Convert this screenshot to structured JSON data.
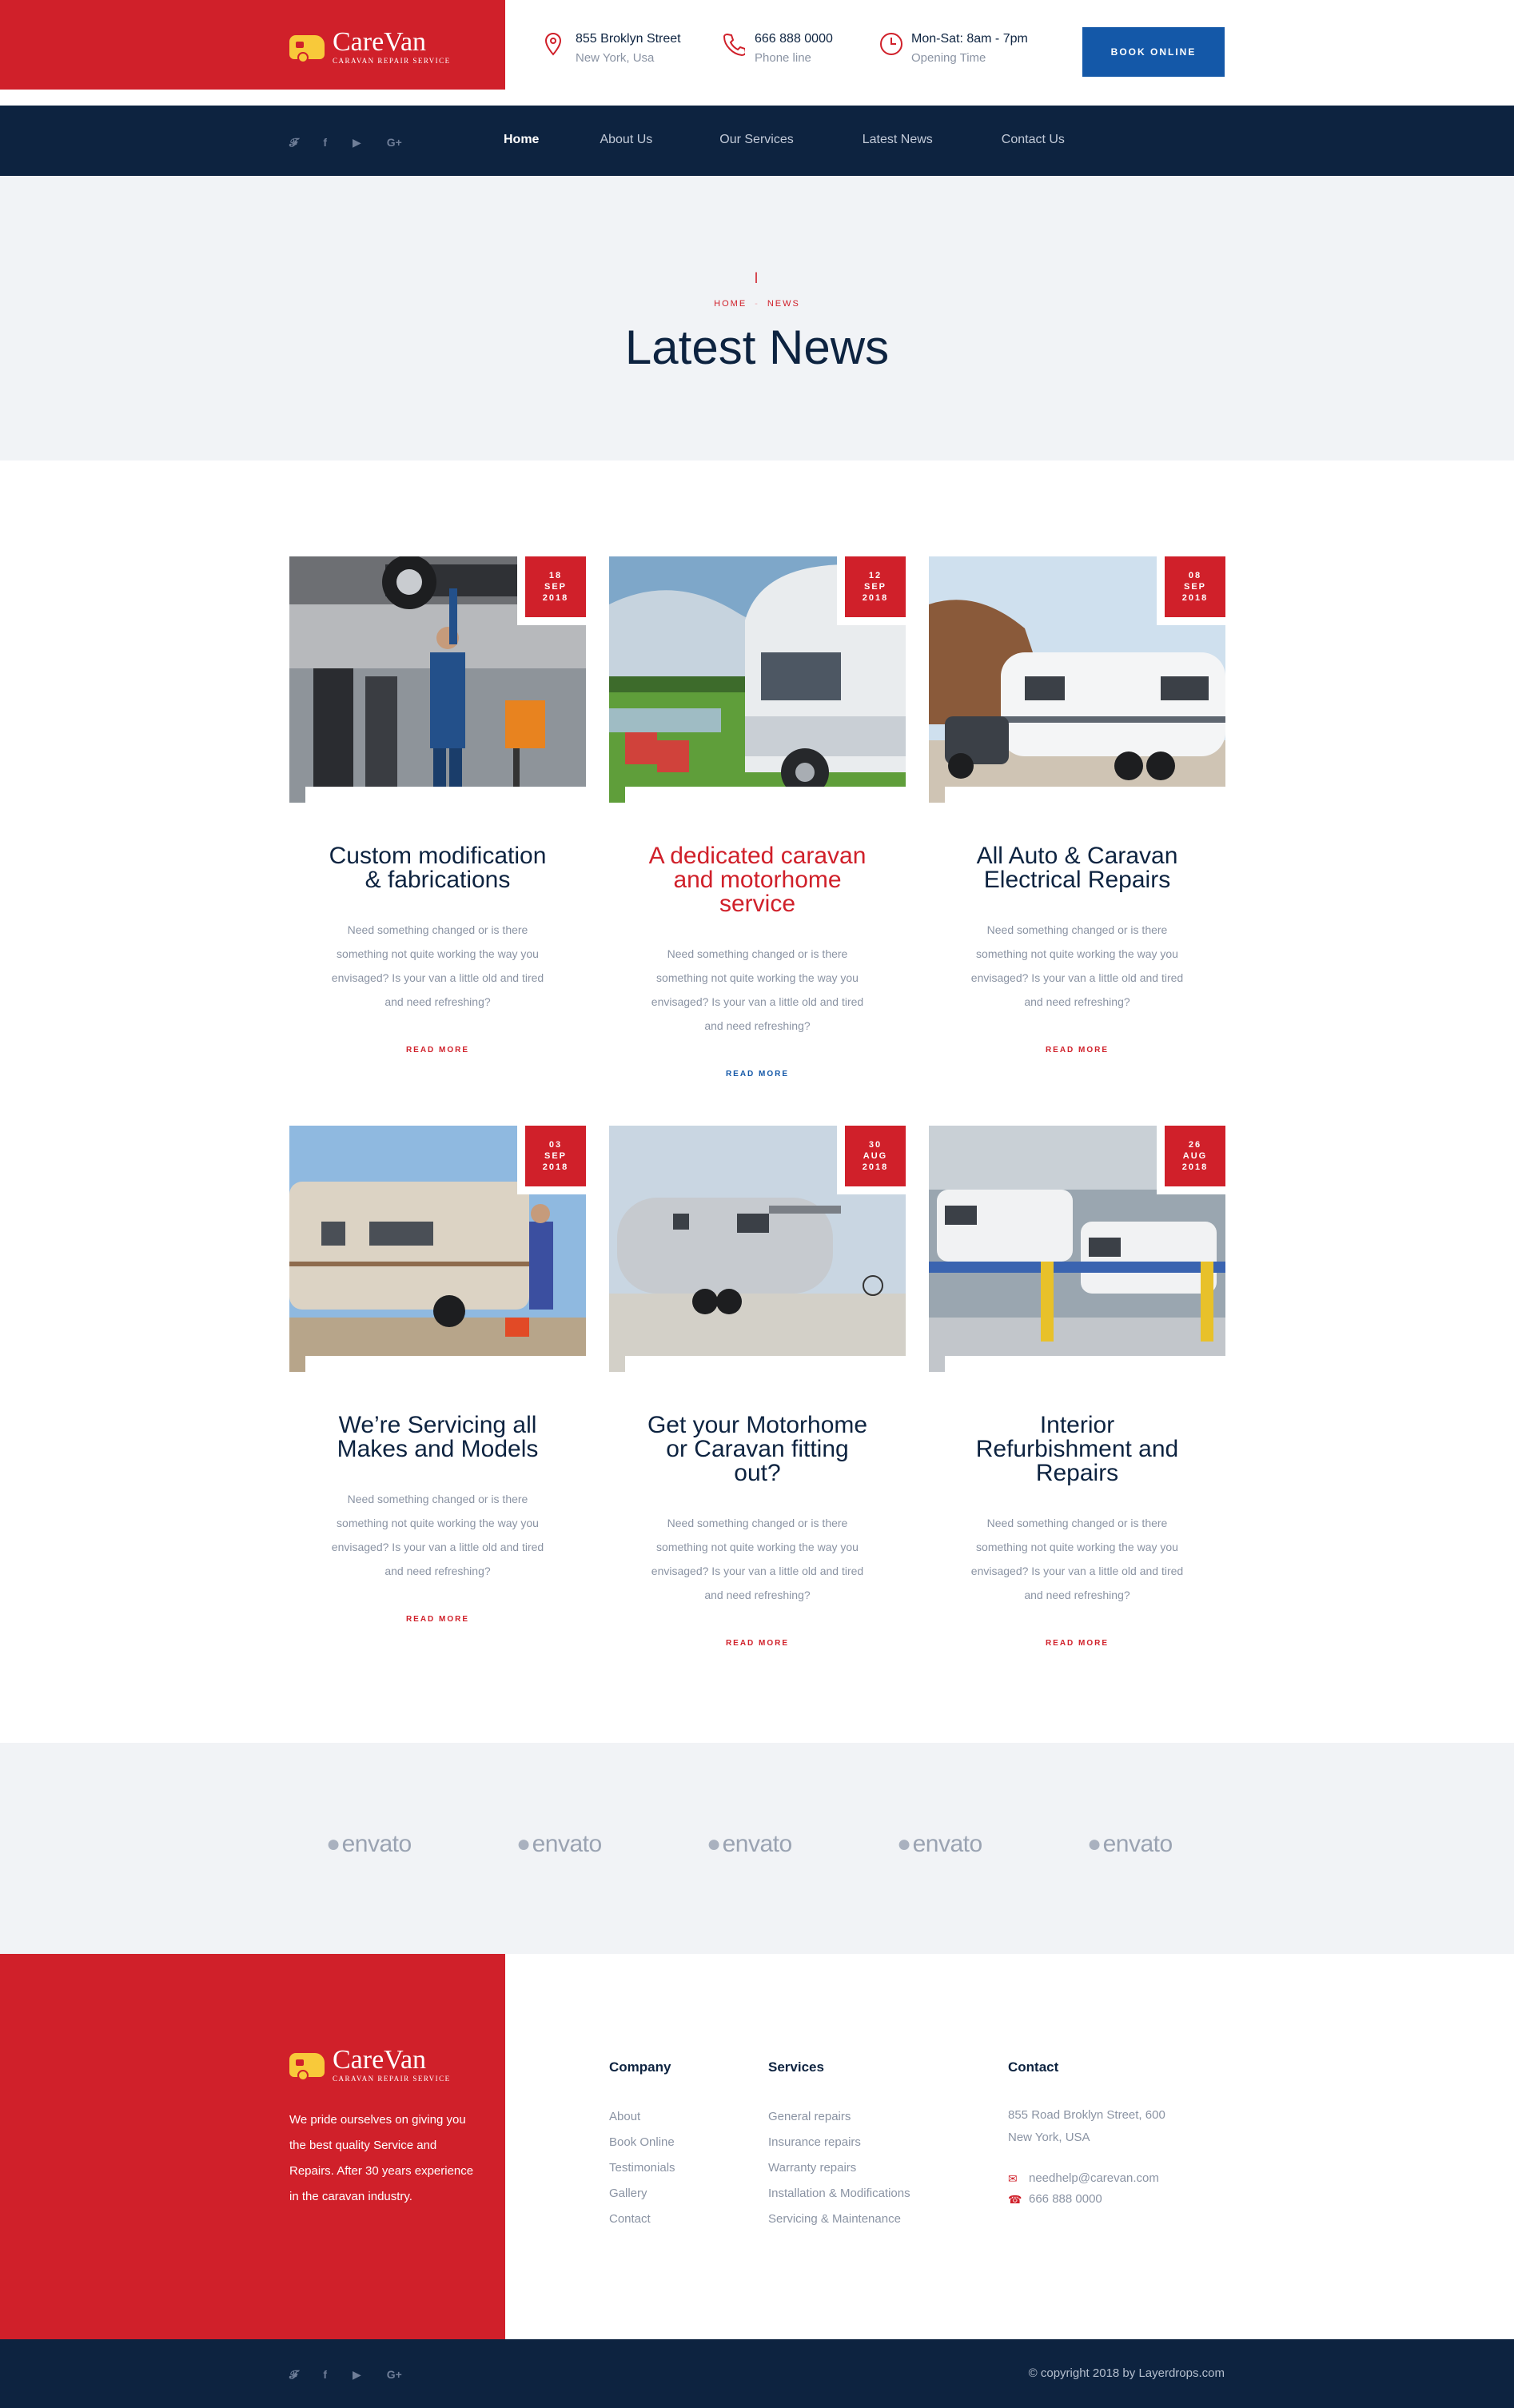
{
  "brand": {
    "name": "CareVan",
    "tagline": "Caravan Repair Service",
    "primary_color": "#d0202a",
    "dark_color": "#0d2340",
    "accent_color": "#1458a8"
  },
  "header": {
    "address": {
      "icon": "location-pin-icon",
      "line1": "855 Broklyn Street",
      "line2": "New York, Usa"
    },
    "phone": {
      "icon": "phone-icon",
      "line1": "666 888 0000",
      "line2": "Phone line"
    },
    "hours": {
      "icon": "clock-icon",
      "line1": "Mon-Sat: 8am - 7pm",
      "line2": "Opening Time"
    },
    "book_label": "BOOK ONLINE"
  },
  "social": [
    "twitter-icon",
    "facebook-icon",
    "youtube-icon",
    "google-plus-icon"
  ],
  "nav": {
    "items": [
      "Home",
      "About Us",
      "Our Services",
      "Latest News",
      "Contact Us"
    ],
    "active": "Home"
  },
  "hero": {
    "breadcrumb_home": "HOME",
    "breadcrumb_sep": "-",
    "breadcrumb_current": "NEWS",
    "title": "Latest News"
  },
  "posts": [
    {
      "day": "18",
      "month": "SEP",
      "year": "2018",
      "title": "Custom modification & fabrications",
      "excerpt": "Need something changed or is there something not quite working the way you envisaged? Is your van a little old and tired and need refreshing?",
      "read_more": "READ MORE",
      "highlight": false
    },
    {
      "day": "12",
      "month": "SEP",
      "year": "2018",
      "title": "A dedicated caravan and motorhome service",
      "excerpt": "Need something changed or is there something not quite working the way you envisaged? Is your van a little old and tired and need refreshing?",
      "read_more": "READ MORE",
      "highlight": true
    },
    {
      "day": "08",
      "month": "SEP",
      "year": "2018",
      "title": "All Auto & Caravan Electrical Repairs",
      "excerpt": "Need something changed or is there something not quite working the way you envisaged? Is your van a little old and tired and need refreshing?",
      "read_more": "READ MORE",
      "highlight": false
    },
    {
      "day": "03",
      "month": "SEP",
      "year": "2018",
      "title": "We’re Servicing all Makes and Models",
      "excerpt": "Need something changed or is there something not quite working the way you envisaged? Is your van a little old and tired and need refreshing?",
      "read_more": "READ MORE",
      "highlight": false
    },
    {
      "day": "30",
      "month": "AUG",
      "year": "2018",
      "title": "Get your Motorhome or Caravan fitting out?",
      "excerpt": "Need something changed or is there something not quite working the way you envisaged? Is your van a little old and tired and need refreshing?",
      "read_more": "READ MORE",
      "highlight": false
    },
    {
      "day": "26",
      "month": "AUG",
      "year": "2018",
      "title": "Interior Refurbishment and Repairs",
      "excerpt": "Need something changed or is there something not quite working the way you envisaged? Is your van a little old and tired and need refreshing?",
      "read_more": "READ MORE",
      "highlight": false
    }
  ],
  "partners": [
    "envato",
    "envato",
    "envato",
    "envato",
    "envato"
  ],
  "footer": {
    "about": "We pride ourselves on giving you the best quality Service and Repairs. After 30 years experience in the caravan industry.",
    "company": {
      "title": "Company",
      "links": [
        "About",
        "Book Online",
        "Testimonials",
        "Gallery",
        "Contact"
      ]
    },
    "services": {
      "title": "Services",
      "links": [
        "General repairs",
        "Insurance repairs",
        "Warranty repairs",
        "Installation & Modifications",
        "Servicing & Maintenance"
      ]
    },
    "contact": {
      "title": "Contact",
      "address1": "855 Road Broklyn Street, 600",
      "address2": "New York, USA",
      "email": "needhelp@carevan.com",
      "phone": "666 888 0000"
    },
    "copyright": "© copyright 2018 by Layerdrops.com"
  }
}
